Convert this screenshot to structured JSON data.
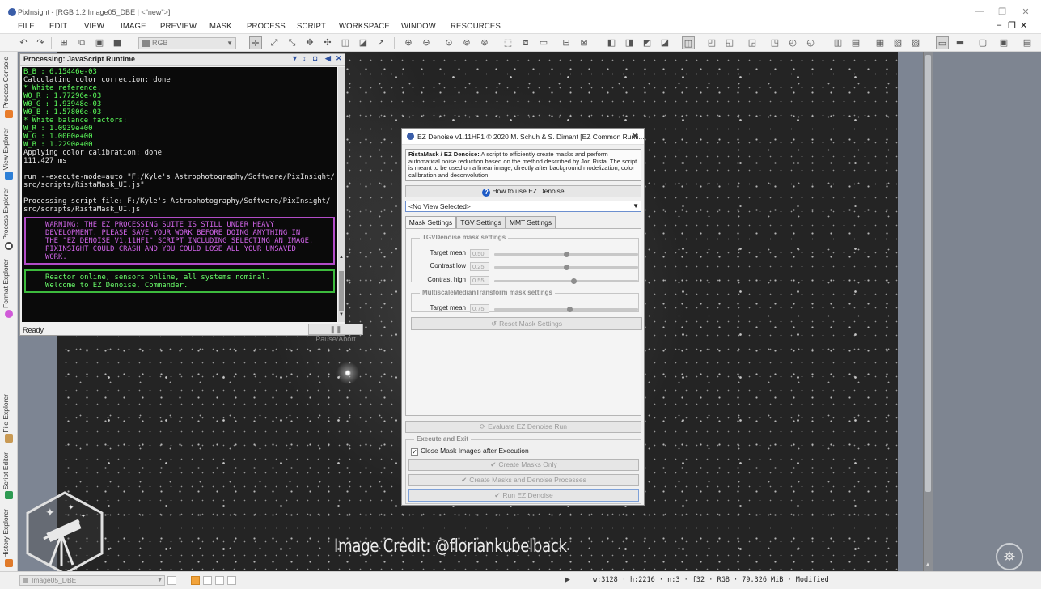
{
  "window": {
    "title": "PixInsight - [RGB 1:2 Image05_DBE | <\"new\">]",
    "minimize": "—",
    "restore": "❐",
    "close": "✕"
  },
  "menubar": {
    "items": [
      "FILE",
      "EDIT",
      "VIEW",
      "IMAGE",
      "PREVIEW",
      "MASK",
      "PROCESS",
      "SCRIPT",
      "WORKSPACE",
      "WINDOW",
      "RESOURCES"
    ],
    "mdi_controls": [
      "‒",
      "❐",
      "✕"
    ]
  },
  "toolbar": {
    "view_combo_value": "RGB",
    "icons": [
      "undo-icon",
      "redo-icon",
      "view-icons",
      "zoom-icons",
      "selection-icons",
      "mask-icons",
      "display-icons"
    ]
  },
  "sidebar": {
    "tabs": [
      {
        "label": "Process Console",
        "color": "#e87d2c"
      },
      {
        "label": "View Explorer",
        "color": "#2d7fd6"
      },
      {
        "label": "Process Explorer",
        "color": "#444444"
      },
      {
        "label": "Format Explorer",
        "color": "#d05ad8"
      },
      {
        "label": "File Explorer",
        "color": "#c99a54"
      },
      {
        "label": "Script Editor",
        "color": "#2e9a52"
      },
      {
        "label": "History Explorer",
        "color": "#e07a2a"
      }
    ]
  },
  "process_console": {
    "title": "Processing: JavaScript Runtime",
    "controls": [
      "▼",
      "↕",
      "◘",
      "◀",
      "✕"
    ],
    "lines_top": [
      {
        "text": "B_B : 6.15446e-03",
        "green": true
      },
      {
        "text": "Calculating color correction: done",
        "green": false
      },
      {
        "text": "* White reference:",
        "green": true
      },
      {
        "text": "W0_R : 1.77296e-03",
        "green": true
      },
      {
        "text": "W0_G : 1.93948e-03",
        "green": true
      },
      {
        "text": "W0_B : 1.57806e-03",
        "green": true
      },
      {
        "text": "* White balance factors:",
        "green": true
      },
      {
        "text": "W_R : 1.0939e+00",
        "green": true
      },
      {
        "text": "W_G : 1.0000e+00",
        "green": true
      },
      {
        "text": "W_B : 1.2290e+00",
        "green": true
      },
      {
        "text": "Applying color calibration: done",
        "green": false
      },
      {
        "text": "111.427 ms",
        "green": false
      },
      {
        "text": "",
        "green": false
      },
      {
        "text": "run --execute-mode=auto \"F:/Kyle's Astrophotography/Software/PixInsight/",
        "green": false
      },
      {
        "text": "src/scripts/RistaMask_UI.js\"",
        "green": false
      },
      {
        "text": "",
        "green": false
      },
      {
        "text": "Processing script file: F:/Kyle's Astrophotography/Software/PixInsight/",
        "green": false
      },
      {
        "text": "src/scripts/RistaMask_UI.js",
        "green": false
      }
    ],
    "warning_lines": [
      "WARNING: THE EZ PROCESSING SUITE IS STILL UNDER HEAVY",
      "DEVELOPMENT. PLEASE SAVE YOUR WORK BEFORE DOING ANYTHING IN",
      "THE \"EZ DENOISE V1.11HF1\" SCRIPT INCLUDING SELECTING AN IMAGE.",
      "PIXINSIGHT COULD CRASH AND YOU COULD LOSE ALL YOUR UNSAVED",
      "WORK."
    ],
    "ok_lines": [
      "Reactor online, sensors online, all systems nominal.",
      "Welcome to EZ Denoise, Commander."
    ],
    "status": "Ready",
    "pause_button": "Pause/Abort"
  },
  "ez_dialog": {
    "title": "EZ Denoise v1.11HF1 © 2020 M. Schuh & S. Dimant [EZ Common Runti...",
    "description_bold": "RistaMask / EZ Denoise:",
    "description": " A script to efficiently create masks and perform automatical noise reduction based on the method described by Jon Rista. The script is meant to be used on a linear image, directly after background modelization, color calibration and deconvolution.",
    "help_button": "How to use EZ Denoise",
    "view_select": "<No View Selected>",
    "tabs": [
      "Mask Settings",
      "TGV Settings",
      "MMT Settings"
    ],
    "tgv_group_title": "TGVDenoise mask settings",
    "tgv_rows": [
      {
        "label": "Target mean",
        "value": "0.50",
        "fraction": 0.5
      },
      {
        "label": "Contrast low",
        "value": "0.25",
        "fraction": 0.5
      },
      {
        "label": "Contrast high",
        "value": "0.55",
        "fraction": 0.55
      }
    ],
    "mmt_group_title": "MultiscaleMedianTransform mask settings",
    "mmt_rows": [
      {
        "label": "Target mean",
        "value": "0.75",
        "fraction": 0.52
      }
    ],
    "reset_button": "Reset Mask Settings",
    "evaluate_button": "Evaluate EZ Denoise Run",
    "exec_group_title": "Execute and Exit",
    "close_masks_label": "Close Mask Images after Execution",
    "close_masks_checked": "✓",
    "create_masks_button": "Create Masks Only",
    "create_masks_denoise_button": "Create Masks and Denoise Processes",
    "run_button": "Run EZ Denoise"
  },
  "overlay": {
    "credit": "Image Credit: @floriankubelback"
  },
  "statusbar": {
    "view_selector": "Image05_DBE",
    "info": "w:3128 · h:2216 · n:3 · f32 · RGB · 79.326 MiB · Modified",
    "accent_color": "#f2a33a"
  }
}
